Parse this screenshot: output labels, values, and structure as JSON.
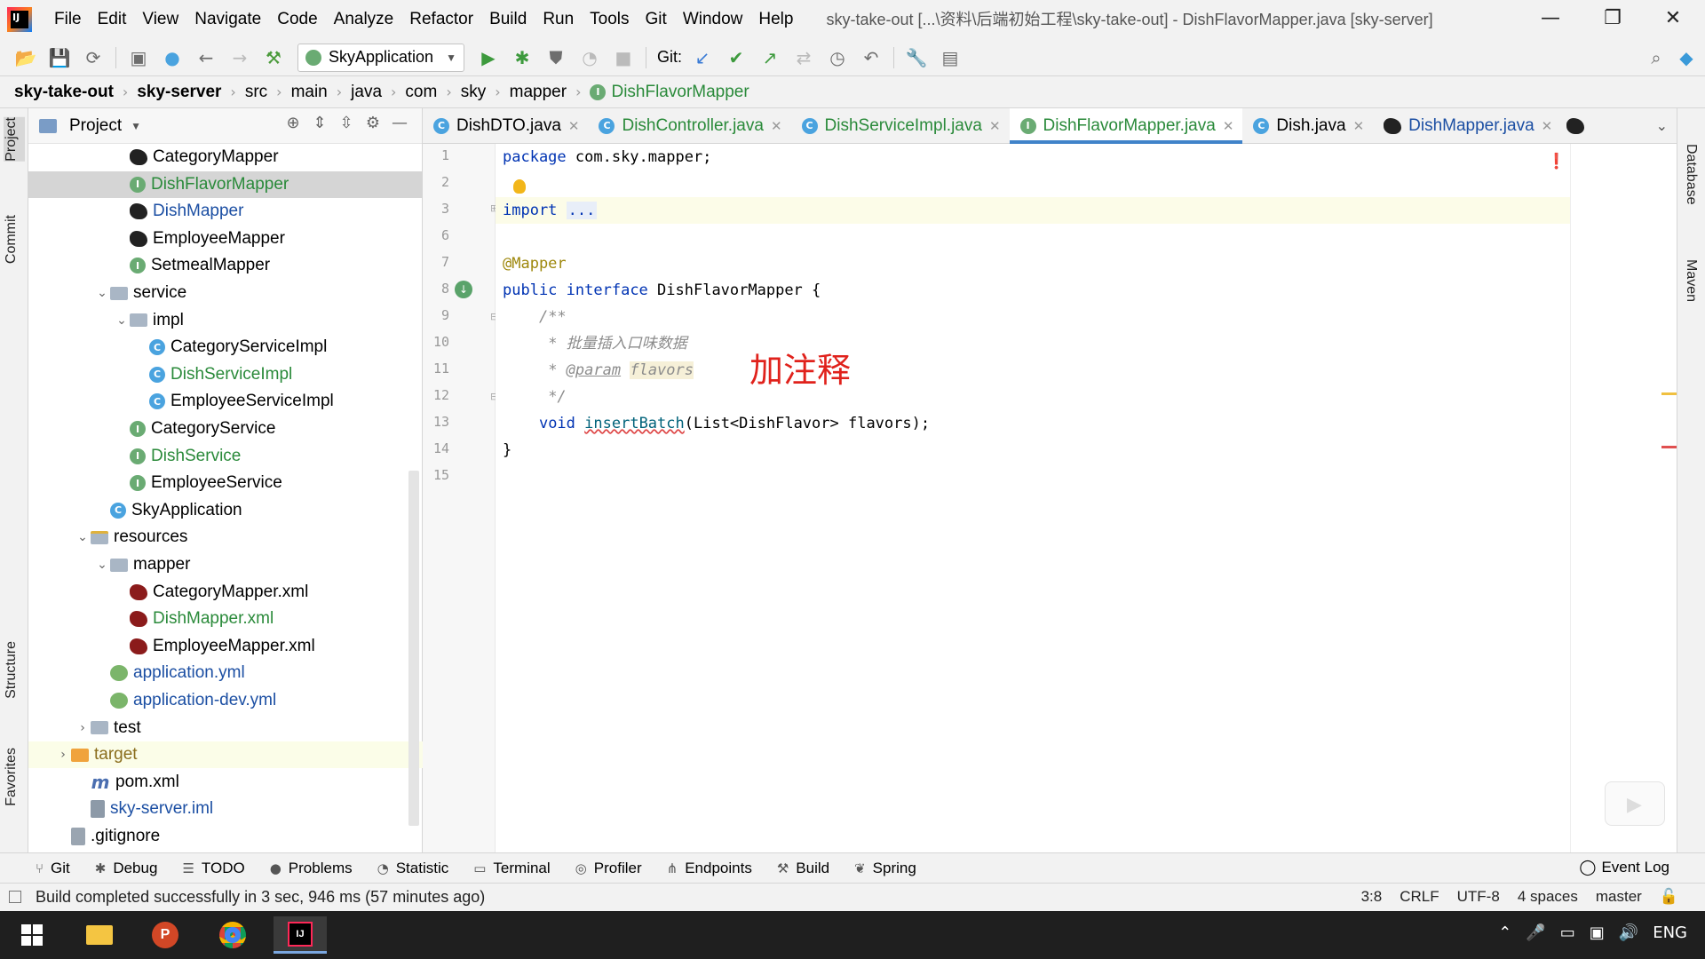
{
  "app": {
    "logo_text": "IJ"
  },
  "menu": [
    "File",
    "Edit",
    "View",
    "Navigate",
    "Code",
    "Analyze",
    "Refactor",
    "Build",
    "Run",
    "Tools",
    "Git",
    "Window",
    "Help"
  ],
  "window_title": "sky-take-out [...\\资料\\后端初始工程\\sky-take-out] - DishFlavorMapper.java [sky-server]",
  "window_controls": {
    "minimize": "—",
    "restore": "❐",
    "close": "✕"
  },
  "toolbar": {
    "run_config": "SkyApplication",
    "git_label": "Git:"
  },
  "breadcrumb": [
    "sky-take-out",
    "sky-server",
    "src",
    "main",
    "java",
    "com",
    "sky",
    "mapper",
    "DishFlavorMapper"
  ],
  "left_strip": {
    "project": "Project",
    "commit": "Commit",
    "structure": "Structure",
    "favorites": "Favorites"
  },
  "right_strip": {
    "database": "Database",
    "maven": "Maven"
  },
  "project_pane": {
    "title": "Project",
    "tree": [
      {
        "label": "CategoryMapper",
        "icon": "mybatis-bird-icon",
        "indent": 4,
        "style": "normal"
      },
      {
        "label": "DishFlavorMapper",
        "icon": "interface-icon",
        "indent": 4,
        "style": "green"
      },
      {
        "label": "DishMapper",
        "icon": "mybatis-bird-icon",
        "indent": 4,
        "style": "blue"
      },
      {
        "label": "EmployeeMapper",
        "icon": "mybatis-bird-icon",
        "indent": 4,
        "style": "normal"
      },
      {
        "label": "SetmealMapper",
        "icon": "interface-icon",
        "indent": 4,
        "style": "normal"
      },
      {
        "label": "service",
        "icon": "folder-icon",
        "indent": 3,
        "style": "normal"
      },
      {
        "label": "impl",
        "icon": "folder-icon",
        "indent": 4,
        "style": "normal"
      },
      {
        "label": "CategoryServiceImpl",
        "icon": "class-icon",
        "indent": 5,
        "style": "normal"
      },
      {
        "label": "DishServiceImpl",
        "icon": "class-icon",
        "indent": 5,
        "style": "green"
      },
      {
        "label": "EmployeeServiceImpl",
        "icon": "class-icon",
        "indent": 5,
        "style": "normal"
      },
      {
        "label": "CategoryService",
        "icon": "interface-icon",
        "indent": 4,
        "style": "normal"
      },
      {
        "label": "DishService",
        "icon": "interface-icon",
        "indent": 4,
        "style": "green"
      },
      {
        "label": "EmployeeService",
        "icon": "interface-icon",
        "indent": 4,
        "style": "normal"
      },
      {
        "label": "SkyApplication",
        "icon": "spring-app-icon",
        "indent": 3,
        "style": "normal"
      },
      {
        "label": "resources",
        "icon": "resources-folder-icon",
        "indent": 2,
        "style": "normal"
      },
      {
        "label": "mapper",
        "icon": "folder-icon",
        "indent": 3,
        "style": "normal"
      },
      {
        "label": "CategoryMapper.xml",
        "icon": "mybatis-xml-icon",
        "indent": 4,
        "style": "normal"
      },
      {
        "label": "DishMapper.xml",
        "icon": "mybatis-xml-icon",
        "indent": 4,
        "style": "green"
      },
      {
        "label": "EmployeeMapper.xml",
        "icon": "mybatis-xml-icon",
        "indent": 4,
        "style": "normal"
      },
      {
        "label": "application.yml",
        "icon": "yml-icon",
        "indent": 3,
        "style": "blue"
      },
      {
        "label": "application-dev.yml",
        "icon": "yml-icon",
        "indent": 3,
        "style": "blue"
      },
      {
        "label": "test",
        "icon": "folder-icon",
        "indent": 2,
        "style": "normal"
      },
      {
        "label": "target",
        "icon": "folder-orange-icon",
        "indent": 1,
        "style": "olive"
      },
      {
        "label": "pom.xml",
        "icon": "maven-icon",
        "indent": 2,
        "style": "normal"
      },
      {
        "label": "sky-server.iml",
        "icon": "iml-icon",
        "indent": 2,
        "style": "blue"
      },
      {
        "label": ".gitignore",
        "icon": "gitignore-icon",
        "indent": 1,
        "style": "normal"
      }
    ]
  },
  "editor": {
    "tabs": [
      {
        "label": "DishDTO.java",
        "icon": "class-icon",
        "style": "normal",
        "active": false
      },
      {
        "label": "DishController.java",
        "icon": "class-icon",
        "style": "green",
        "active": false
      },
      {
        "label": "DishServiceImpl.java",
        "icon": "class-icon",
        "style": "green",
        "active": false
      },
      {
        "label": "DishFlavorMapper.java",
        "icon": "interface-icon",
        "style": "green",
        "active": true
      },
      {
        "label": "Dish.java",
        "icon": "class-icon",
        "style": "normal",
        "active": false
      },
      {
        "label": "DishMapper.java",
        "icon": "mybatis-bird-icon",
        "style": "blue",
        "active": false
      }
    ],
    "line_numbers": [
      "1",
      "2",
      "3",
      "6",
      "7",
      "8",
      "9",
      "10",
      "11",
      "12",
      "13",
      "14",
      "15"
    ],
    "code": {
      "l1_kw": "package",
      "l1_rest": " com.sky.mapper;",
      "l3_kw": "import",
      "l3_fold": "...",
      "l7_ann": "@Mapper",
      "l8_kw1": "public",
      "l8_kw2": "interface",
      "l8_rest": " DishFlavorMapper {",
      "l9_cmt": "/**",
      "l10_cmt": "* 批量插入口味数据",
      "l11_star": "* ",
      "l11_tag": "@param",
      "l11_param": "flavors",
      "l12_cmt": "*/",
      "l13_kw": "void",
      "l13_method": "insertBatch",
      "l13_rest": "(List<DishFlavor> flavors);",
      "l14": "}"
    },
    "annotation_note": "加注释",
    "inspections": {
      "errors": "1",
      "warnings": "1"
    }
  },
  "tool_windows": [
    "Git",
    "Debug",
    "TODO",
    "Problems",
    "Statistic",
    "Terminal",
    "Profiler",
    "Endpoints",
    "Build",
    "Spring"
  ],
  "event_log": "Event Log",
  "status": {
    "message": "Build completed successfully in 3 sec, 946 ms (57 minutes ago)",
    "position": "3:8",
    "line_sep": "CRLF",
    "encoding": "UTF-8",
    "indent": "4 spaces",
    "branch": "master"
  },
  "taskbar": {
    "lang": "ENG"
  },
  "colors": {
    "accent": "#4083c9",
    "green_file": "#2a8a3a",
    "note_red": "#e0221c"
  }
}
